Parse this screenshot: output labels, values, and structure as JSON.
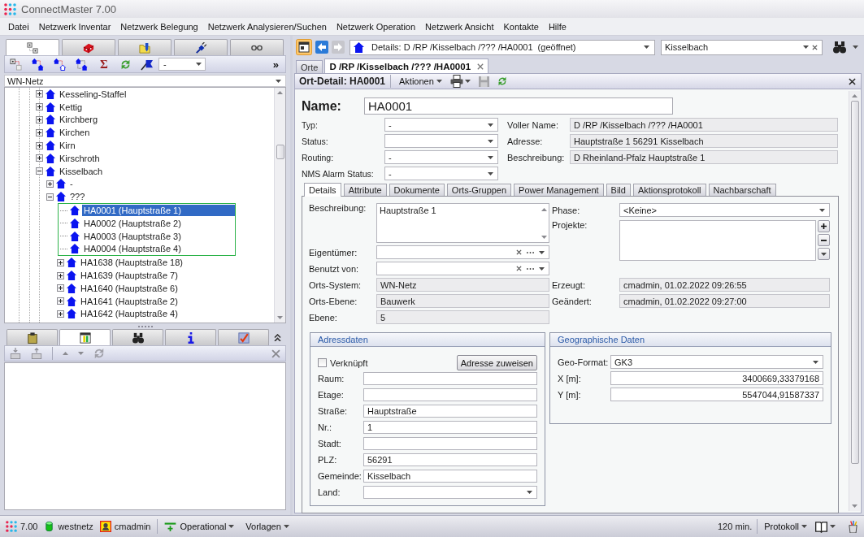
{
  "window": {
    "title": "ConnectMaster 7.00"
  },
  "menu": [
    "Datei",
    "Netzwerk Inventar",
    "Netzwerk Belegung",
    "Netzwerk Analysieren/Suchen",
    "Netzwerk Operation",
    "Netzwerk Ansicht",
    "Kontakte",
    "Hilfe"
  ],
  "navigator": {
    "tabs": [
      {
        "selected": true
      },
      {
        "selected": false
      },
      {
        "selected": false
      },
      {
        "selected": false
      },
      {
        "selected": false
      }
    ],
    "toolbar": {
      "sum_label": "Σ",
      "filter_value": "-",
      "more_label": "»"
    },
    "network": "WN-Netz",
    "tree": [
      {
        "kind": "node",
        "label": "Kesseling-Staffel",
        "expanded": false,
        "selected": false
      },
      {
        "kind": "node",
        "label": "Kettig",
        "expanded": false,
        "selected": false
      },
      {
        "kind": "node",
        "label": "Kirchberg",
        "expanded": false,
        "selected": false
      },
      {
        "kind": "node",
        "label": "Kirchen",
        "expanded": false,
        "selected": false
      },
      {
        "kind": "node",
        "label": "Kirn",
        "expanded": false,
        "selected": false
      },
      {
        "kind": "node",
        "label": "Kirschroth",
        "expanded": false,
        "selected": false
      },
      {
        "kind": "node",
        "label": "Kisselbach",
        "expanded": true,
        "selected": false,
        "children": [
          {
            "kind": "node",
            "label": "-",
            "expanded": false,
            "selected": false
          },
          {
            "kind": "node",
            "label": "???",
            "expanded": true,
            "selected": false,
            "children": [
              {
                "kind": "leaf",
                "label": "HA0001 (Hauptstraße 1)",
                "selected": true,
                "highlighted": true
              },
              {
                "kind": "leaf",
                "label": "HA0002 (Hauptstraße 2)",
                "selected": false,
                "highlighted": true
              },
              {
                "kind": "leaf",
                "label": "HA0003 (Hauptstraße 3)",
                "selected": false,
                "highlighted": true
              },
              {
                "kind": "leaf",
                "label": "HA0004 (Hauptstraße 4)",
                "selected": false,
                "highlighted": true
              },
              {
                "kind": "node",
                "label": "HA1638 (Hauptstraße 18)",
                "expanded": false,
                "selected": false,
                "highlighted": false
              },
              {
                "kind": "node",
                "label": "HA1639 (Hauptstraße 7)",
                "expanded": false,
                "selected": false,
                "highlighted": false
              },
              {
                "kind": "node",
                "label": "HA1640 (Hauptstraße 6)",
                "expanded": false,
                "selected": false,
                "highlighted": false
              },
              {
                "kind": "node",
                "label": "HA1641 (Hauptstraße 2)",
                "expanded": false,
                "selected": false,
                "highlighted": false
              },
              {
                "kind": "node",
                "label": "HA1642 (Hauptstraße 4)",
                "expanded": false,
                "selected": false,
                "highlighted": false
              }
            ]
          }
        ]
      }
    ]
  },
  "lower_panel": {
    "tabs": [
      {
        "selected": false
      },
      {
        "selected": true
      },
      {
        "selected": false
      },
      {
        "selected": false
      },
      {
        "selected": false
      }
    ]
  },
  "navigation": {
    "address": "Details: D /RP /Kisselbach /??? /HA0001  (geöffnet)",
    "search": "Kisselbach"
  },
  "documents": [
    {
      "label": "Orte",
      "selected": false,
      "closable": false
    },
    {
      "label": "D /RP /Kisselbach /??? /HA0001",
      "selected": true,
      "closable": true
    }
  ],
  "detail": {
    "title": "Ort-Detail: HA0001",
    "actions": "Aktionen",
    "name": {
      "label": "Name:",
      "value": "HA0001"
    },
    "fields": [
      {
        "label": "Typ:",
        "value": "-"
      },
      {
        "label": "Status:"
      },
      {
        "label": "Routing:",
        "value": "-"
      },
      {
        "label": "NMS Alarm Status:",
        "value": "-"
      }
    ],
    "info": [
      {
        "label": "Voller Name:",
        "value": "D /RP /Kisselbach /??? /HA0001"
      },
      {
        "label": "Adresse:",
        "value": "Hauptstraße 1 56291 Kisselbach"
      },
      {
        "label": "Beschreibung:",
        "value": "D Rheinland-Pfalz Hauptstraße 1"
      }
    ],
    "tabs": [
      {
        "label": "Details",
        "selected": true
      },
      {
        "label": "Attribute",
        "selected": false
      },
      {
        "label": "Dokumente",
        "selected": false
      },
      {
        "label": "Orts-Gruppen",
        "selected": false
      },
      {
        "label": "Power Management",
        "selected": false
      },
      {
        "label": "Bild",
        "selected": false
      },
      {
        "label": "Aktionsprotokoll",
        "selected": false
      },
      {
        "label": "Nachbarschaft",
        "selected": false
      }
    ],
    "details": {
      "description": {
        "label": "Beschreibung:",
        "value": "Hauptstraße 1"
      },
      "fields": [
        {
          "kind": "lookup",
          "label": "Eigentümer:"
        },
        {
          "kind": "lookup",
          "label": "Benutzt von:"
        },
        {
          "kind": "readonly",
          "label": "Orts-System:",
          "value": "WN-Netz"
        },
        {
          "kind": "readonly",
          "label": "Orts-Ebene:",
          "value": "Bauwerk"
        },
        {
          "kind": "readonly",
          "label": "Ebene:",
          "value": "5"
        }
      ],
      "phase": {
        "label": "Phase:",
        "value": "<Keine>"
      },
      "projects": {
        "label": "Projekte:"
      },
      "history": [
        {
          "label": "Erzeugt:",
          "value": "cmadmin, 01.02.2022 09:26:55"
        },
        {
          "label": "Geändert:",
          "value": "cmadmin, 01.02.2022 09:27:00"
        }
      ]
    },
    "address": {
      "title": "Adressdaten",
      "linked": {
        "label": "Verknüpft",
        "checked": false
      },
      "assign_button": "Adresse zuweisen",
      "fields": [
        {
          "kind": "text",
          "label": "Raum:"
        },
        {
          "kind": "text",
          "label": "Etage:"
        },
        {
          "kind": "text",
          "label": "Straße:",
          "value": "Hauptstraße"
        },
        {
          "kind": "text",
          "label": "Nr.:",
          "value": "1"
        },
        {
          "kind": "text",
          "label": "Stadt:"
        },
        {
          "kind": "text",
          "label": "PLZ:",
          "value": "56291"
        },
        {
          "kind": "text",
          "label": "Gemeinde:",
          "value": "Kisselbach"
        },
        {
          "kind": "dropdown",
          "label": "Land:"
        }
      ]
    },
    "geo": {
      "title": "Geographische Daten",
      "fields": [
        {
          "kind": "dropdown",
          "label": "Geo-Format:",
          "value": "GK3"
        },
        {
          "kind": "number",
          "label": "X [m]:",
          "value": "3400669,33379168"
        },
        {
          "kind": "number",
          "label": "Y [m]:",
          "value": "5547044,91587337"
        }
      ]
    }
  },
  "status_bar": {
    "version": "7.00",
    "database": "westnetz",
    "user": "cmadmin",
    "mode": "Operational",
    "templates": "Vorlagen",
    "timeout": "120 min.",
    "log": "Protokoll"
  }
}
